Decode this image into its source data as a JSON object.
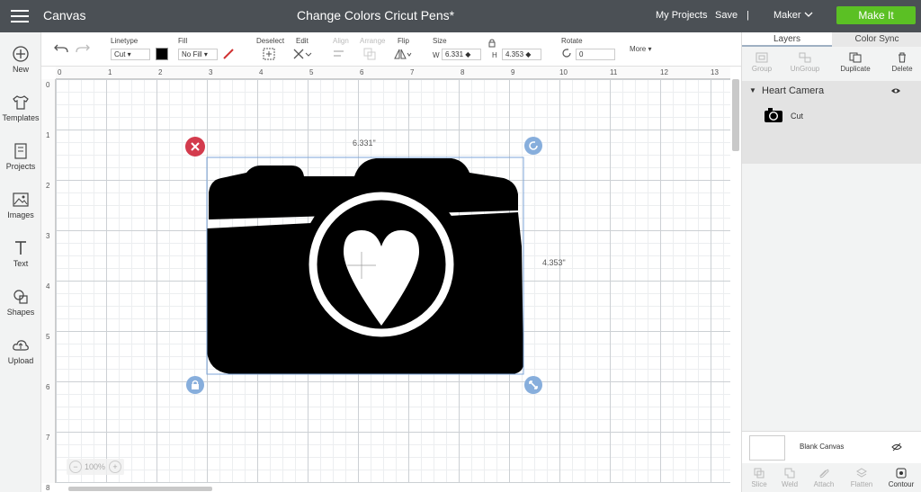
{
  "topbar": {
    "app_title": "Canvas",
    "project_title": "Change Colors Cricut Pens*",
    "my_projects": "My Projects",
    "save": "Save",
    "separator": "|",
    "machine": "Maker",
    "make_it": "Make It",
    "accent_color": "#5bc024"
  },
  "leftbar": {
    "items": [
      {
        "label": "New",
        "icon": "plus-circle-icon"
      },
      {
        "label": "Templates",
        "icon": "tshirt-icon"
      },
      {
        "label": "Projects",
        "icon": "projects-icon"
      },
      {
        "label": "Images",
        "icon": "image-icon"
      },
      {
        "label": "Text",
        "icon": "text-icon"
      },
      {
        "label": "Shapes",
        "icon": "shapes-icon"
      },
      {
        "label": "Upload",
        "icon": "upload-icon"
      }
    ]
  },
  "toolbar": {
    "linetype_label": "Linetype",
    "linetype_value": "Cut",
    "fill_label": "Fill",
    "fill_value": "No Fill",
    "deselect": "Deselect",
    "edit": "Edit",
    "align": "Align",
    "arrange": "Arrange",
    "flip": "Flip",
    "size": "Size",
    "w_label": "W",
    "w_value": "6.331",
    "h_label": "H",
    "h_value": "4.353",
    "rotate": "Rotate",
    "rotate_value": "0",
    "more": "More"
  },
  "canvas": {
    "ruler_h": [
      "0",
      "1",
      "2",
      "3",
      "4",
      "5",
      "6",
      "7",
      "8",
      "9",
      "10",
      "11",
      "12",
      "13"
    ],
    "ruler_v": [
      "0",
      "1",
      "2",
      "3",
      "4",
      "5",
      "6",
      "7",
      "8"
    ],
    "width_label": "6.331\"",
    "height_label": "4.353\"",
    "zoom": "100%"
  },
  "right_panel": {
    "tabs": [
      "Layers",
      "Color Sync"
    ],
    "actions": [
      {
        "label": "Group",
        "enabled": false
      },
      {
        "label": "UnGroup",
        "enabled": false
      },
      {
        "label": "Duplicate",
        "enabled": true
      },
      {
        "label": "Delete",
        "enabled": true
      }
    ],
    "layer_group_name": "Heart Camera",
    "layer_item": "Cut",
    "blank_canvas": "Blank Canvas",
    "bottom_actions": [
      "Slice",
      "Weld",
      "Attach",
      "Flatten",
      "Contour"
    ]
  }
}
